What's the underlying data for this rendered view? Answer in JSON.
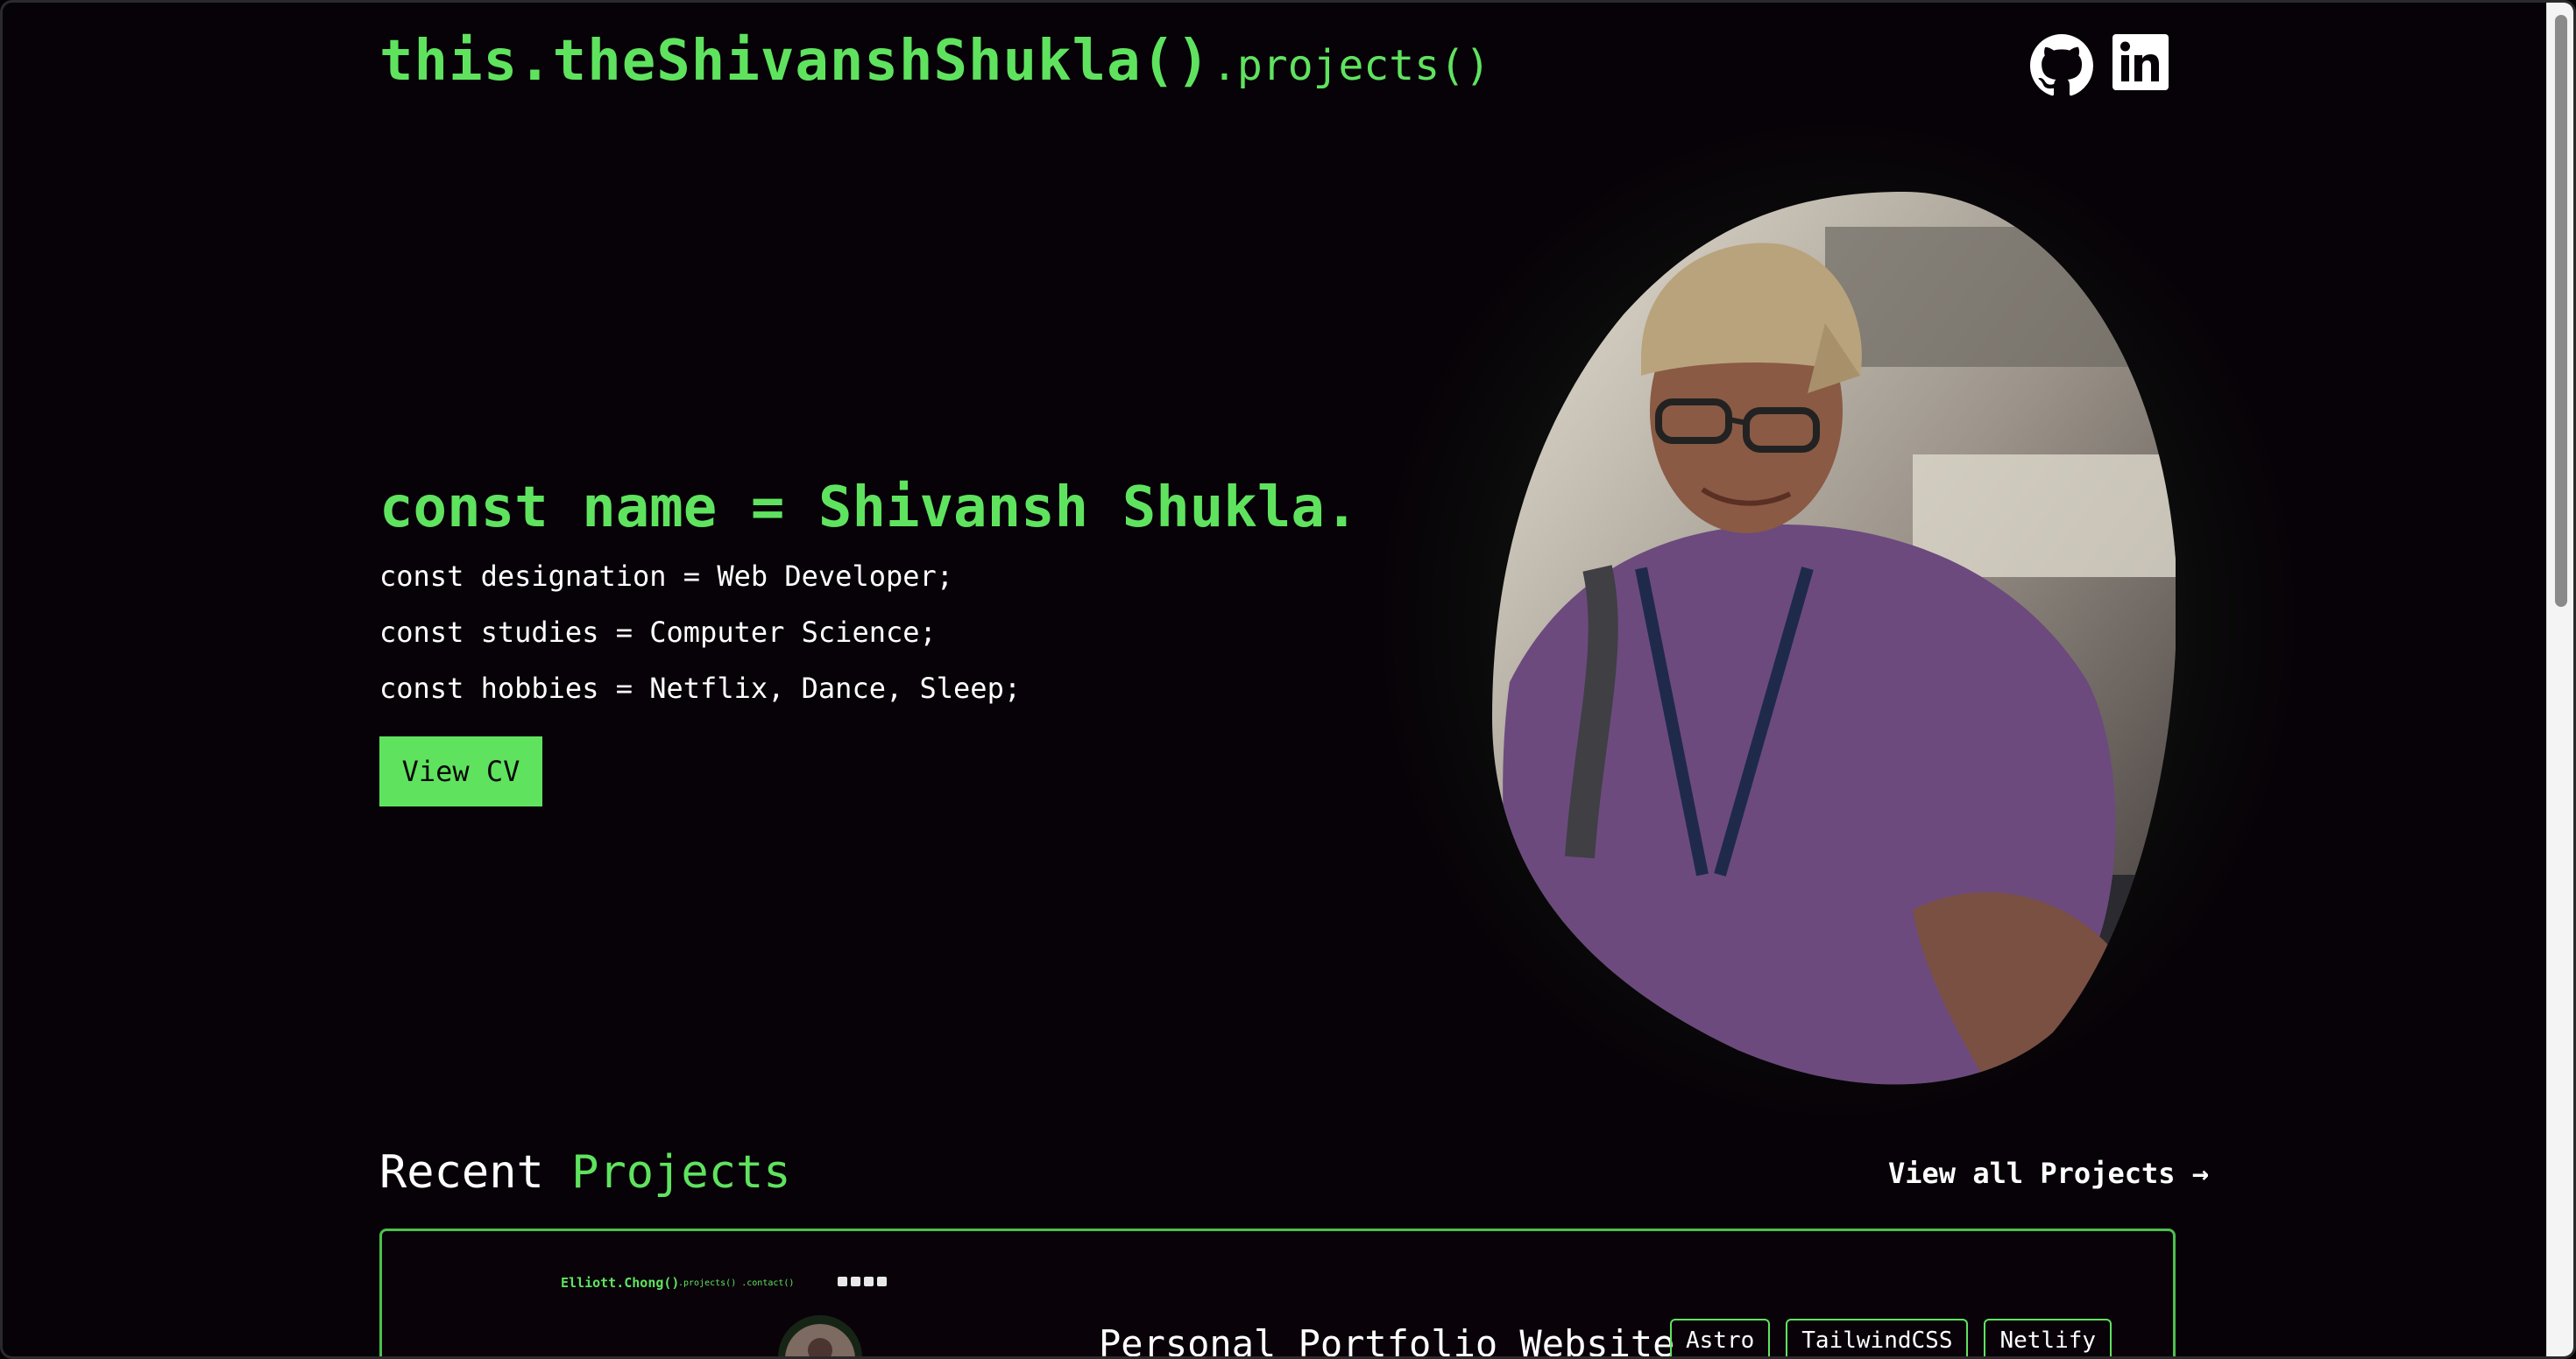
{
  "header": {
    "logo": "this.theShivanshShukla()",
    "nav_projects": ".projects()",
    "social": [
      {
        "name": "github",
        "icon": "github-icon"
      },
      {
        "name": "linkedin",
        "icon": "linkedin-icon"
      }
    ]
  },
  "hero": {
    "name_line": "const name = Shivansh Shukla.",
    "designation_line": "const designation = Web Developer;",
    "studies_line": "const studies = Computer Science;",
    "hobbies_line": "const hobbies = Netflix, Dance, Sleep;",
    "cv_button": "View CV"
  },
  "projects": {
    "heading_plain": "Recent",
    "heading_accent": "Projects",
    "view_all": "View all Projects →",
    "cards": [
      {
        "title": "Personal Portfolio Website",
        "thumbnail": {
          "logo": "Elliott.Chong()",
          "nav": ".projects() .contact()"
        },
        "tags": [
          "Astro",
          "TailwindCSS",
          "Netlify"
        ]
      }
    ]
  },
  "colors": {
    "accent": "#5fe35f",
    "background": "#070207",
    "text": "#ffffff"
  }
}
